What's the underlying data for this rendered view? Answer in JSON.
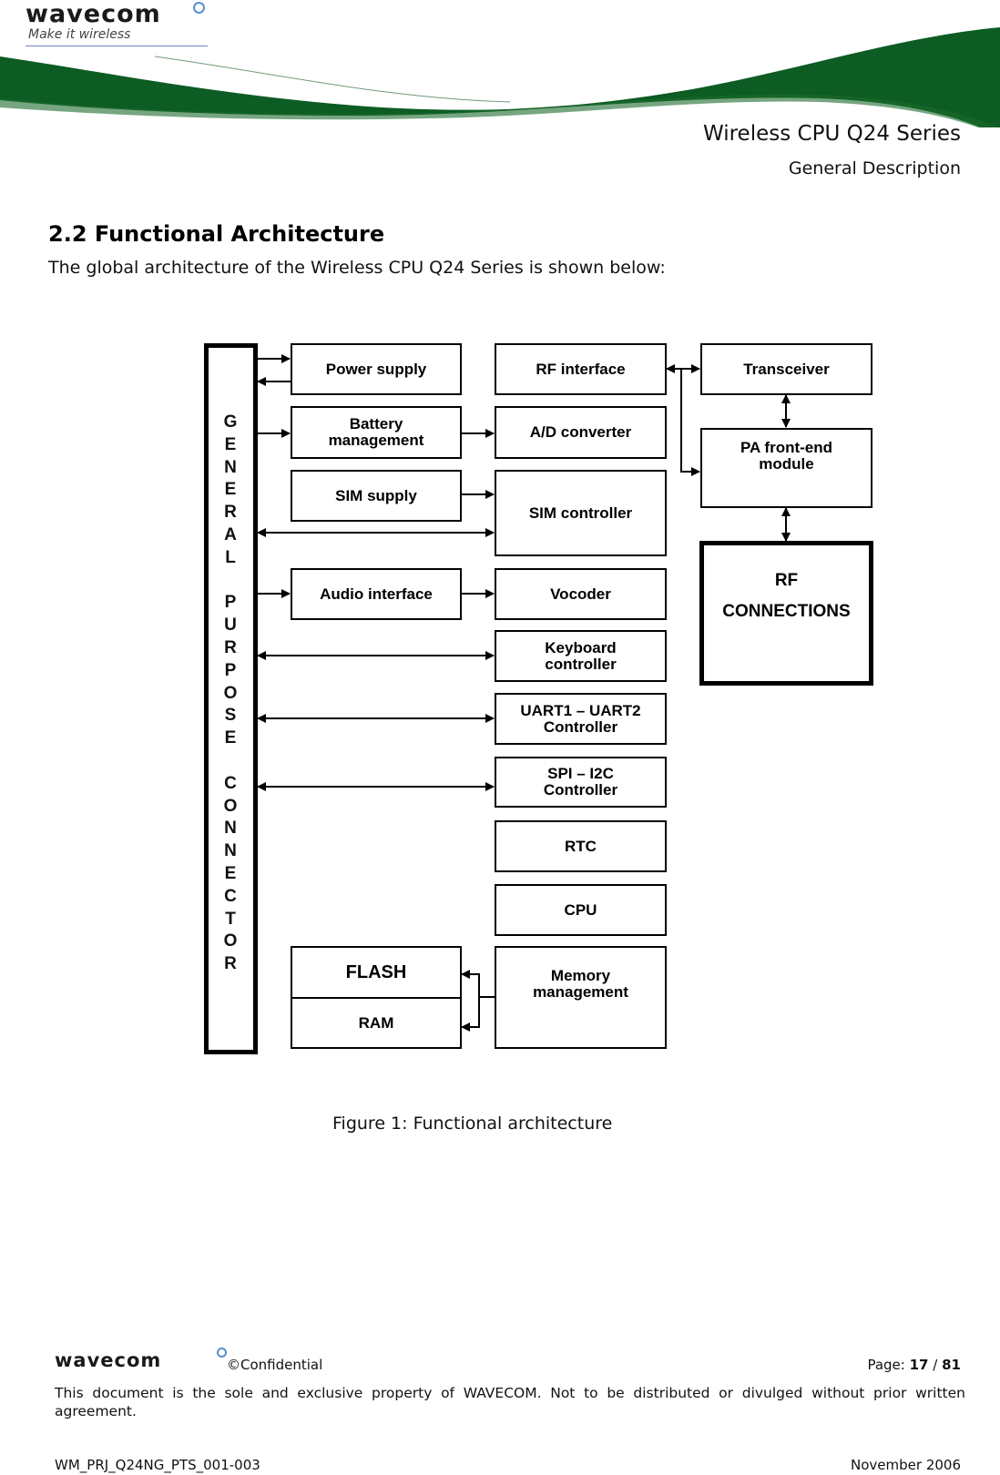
{
  "header": {
    "logo_text": "wavecom",
    "logo_tagline": "Make it wireless",
    "document_title": "Wireless CPU Q24 Series",
    "document_subtitle": "General Description",
    "brand_color": "#0d5c23"
  },
  "section": {
    "title": "2.2 Functional Architecture",
    "intro": "The global architecture of the Wireless CPU Q24 Series is shown below:"
  },
  "diagram": {
    "connector_letters": [
      "G",
      "E",
      "N",
      "E",
      "R",
      "A",
      "L",
      "",
      "P",
      "U",
      "R",
      "P",
      "O",
      "S",
      "E",
      "",
      "C",
      "O",
      "N",
      "N",
      "E",
      "C",
      "T",
      "O",
      "R"
    ],
    "connector_label": "GENERAL PURPOSE CONNECTOR",
    "blocks": {
      "power_supply": "Power supply",
      "battery_management": "Battery management",
      "sim_supply": "SIM supply",
      "audio_interface": "Audio interface",
      "flash": "FLASH",
      "ram": "RAM",
      "rf_interface": "RF interface",
      "ad_converter": "A/D converter",
      "sim_controller": "SIM controller",
      "vocoder": "Vocoder",
      "keyboard_controller": "Keyboard controller",
      "uart_controller": "UART1 – UART2 Controller",
      "spi_i2c_controller": "SPI – I2C Controller",
      "rtc": "RTC",
      "cpu": "CPU",
      "memory_management": "Memory management",
      "transceiver": "Transceiver",
      "pa_front_end": "PA front-end module",
      "rf_connections_line1": "RF",
      "rf_connections_line2": "CONNECTIONS"
    },
    "connections": [
      {
        "from": "General purpose connector",
        "to": "Power supply",
        "type": "one-way"
      },
      {
        "from": "Power supply",
        "to": "General purpose connector",
        "type": "one-way"
      },
      {
        "from": "General purpose connector",
        "to": "Battery management",
        "type": "one-way"
      },
      {
        "from": "Battery management",
        "to": "A/D converter",
        "type": "one-way"
      },
      {
        "from": "SIM supply",
        "to": "SIM controller",
        "type": "one-way"
      },
      {
        "from": "General purpose connector",
        "to": "SIM controller",
        "type": "two-way"
      },
      {
        "from": "General purpose connector",
        "to": "Audio interface",
        "type": "one-way"
      },
      {
        "from": "Audio interface",
        "to": "Vocoder",
        "type": "one-way"
      },
      {
        "from": "General purpose connector",
        "to": "Keyboard controller",
        "type": "two-way"
      },
      {
        "from": "General purpose connector",
        "to": "UART1 – UART2 Controller",
        "type": "two-way"
      },
      {
        "from": "General purpose connector",
        "to": "SPI – I2C Controller",
        "type": "two-way"
      },
      {
        "from": "RF interface",
        "to": "Transceiver",
        "type": "two-way"
      },
      {
        "from": "RF interface",
        "to": "PA front-end module",
        "type": "one-way"
      },
      {
        "from": "Transceiver",
        "to": "PA front-end module",
        "type": "two-way"
      },
      {
        "from": "PA front-end module",
        "to": "RF CONNECTIONS",
        "type": "two-way"
      },
      {
        "from": "Memory management",
        "to": "FLASH",
        "type": "one-way"
      },
      {
        "from": "Memory management",
        "to": "RAM",
        "type": "one-way"
      }
    ],
    "caption": "Figure 1: Functional architecture"
  },
  "footer": {
    "logo_text": "wavecom",
    "confidential": "©Confidential",
    "page_label": "Page:",
    "page_current": "17",
    "page_separator": "/",
    "page_total": "81",
    "notice": "This document is the sole and exclusive property of WAVECOM. Not to be distributed or divulged without prior written agreement.",
    "doc_ref": "WM_PRJ_Q24NG_PTS_001-003",
    "date": "November 2006"
  }
}
